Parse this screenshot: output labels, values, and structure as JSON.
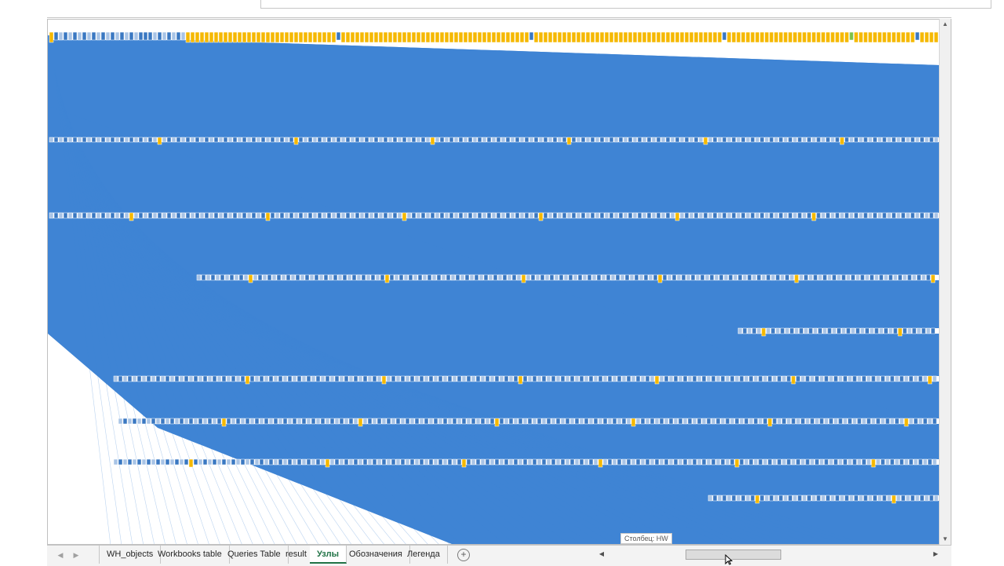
{
  "sheet_tabs": [
    "WH_objects",
    "Workbooks table",
    "Queries Table",
    "result",
    "Узлы",
    "Обозначения",
    "Легенда"
  ],
  "active_tab": "Узлы",
  "add_sheet_label": "+",
  "tooltip": "Столбец: HW",
  "colors": {
    "edge_blue": "#3f84d4",
    "node_blue": "#3a78c2",
    "node_light": "#a8c4e6",
    "node_yellow": "#f5b800",
    "node_green": "#7ec24a"
  },
  "icons": {
    "scroll_left": "triangle-left-icon",
    "scroll_right": "triangle-right-icon",
    "scroll_up": "triangle-up-icon",
    "scroll_down": "triangle-down-icon",
    "add_sheet": "plus-circle-icon",
    "cursor": "mouse-pointer-icon"
  }
}
